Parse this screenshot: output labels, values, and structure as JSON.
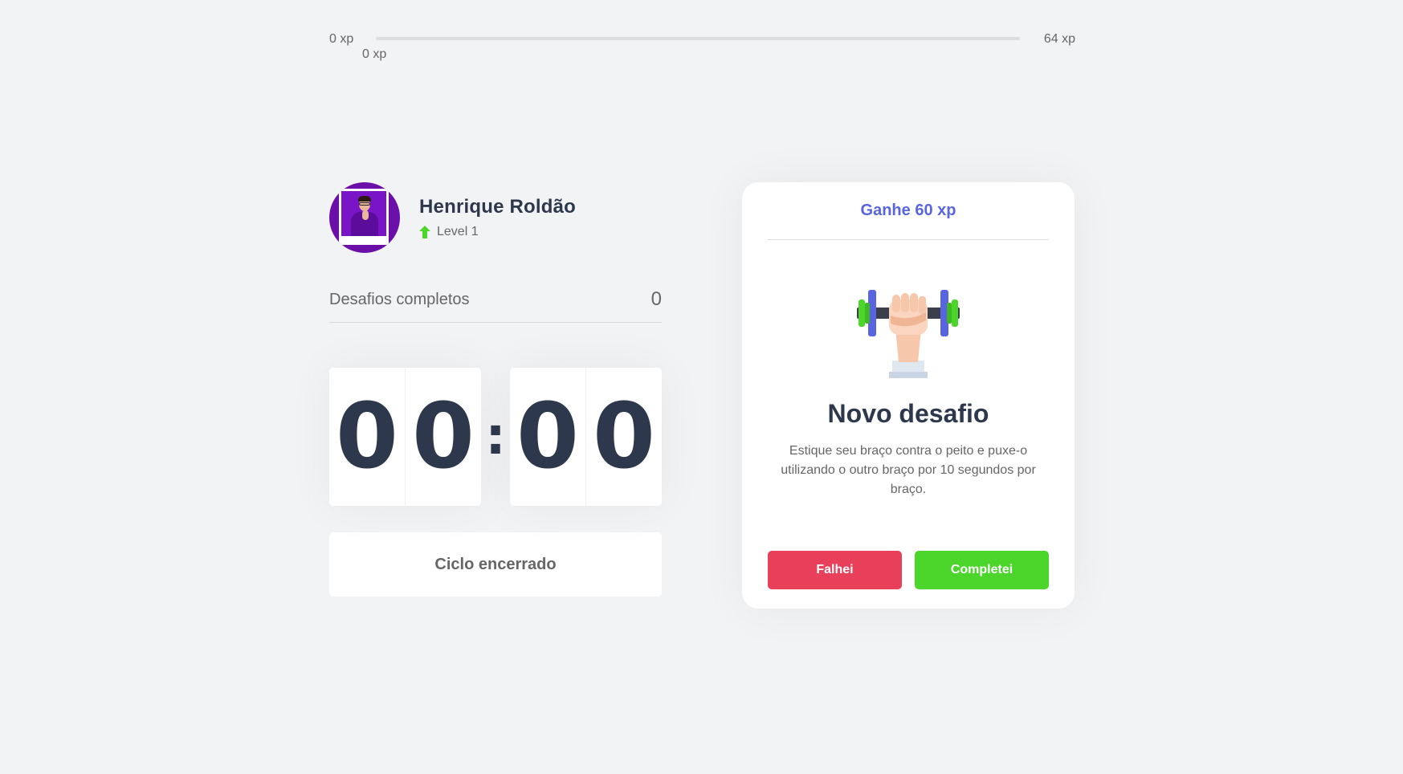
{
  "xp": {
    "min_label": "0 xp",
    "max_label": "64 xp",
    "current_label": "0 xp",
    "progress_fraction": 0
  },
  "profile": {
    "name": "Henrique Roldão",
    "level": "Level 1",
    "level_icon": "arrow-up-icon"
  },
  "challenges": {
    "label": "Desafios completos",
    "count": "0"
  },
  "countdown": {
    "minute_left": "0",
    "minute_right": "0",
    "separator": ":",
    "second_left": "0",
    "second_right": "0"
  },
  "cycle_button": {
    "label": "Ciclo encerrado"
  },
  "challenge_card": {
    "header": "Ganhe 60 xp",
    "icon": "dumbbell-body-icon",
    "title": "Novo desafio",
    "description": "Estique seu braço contra o peito e puxe-o utilizando o outro braço por 10 segundos por braço.",
    "fail_label": "Falhei",
    "success_label": "Completei"
  },
  "colors": {
    "background": "#f2f3f5",
    "title": "#2e384d",
    "text": "#666666",
    "blue": "#5965e0",
    "green": "#4cd62b",
    "red": "#e83f5b",
    "white": "#ffffff"
  }
}
